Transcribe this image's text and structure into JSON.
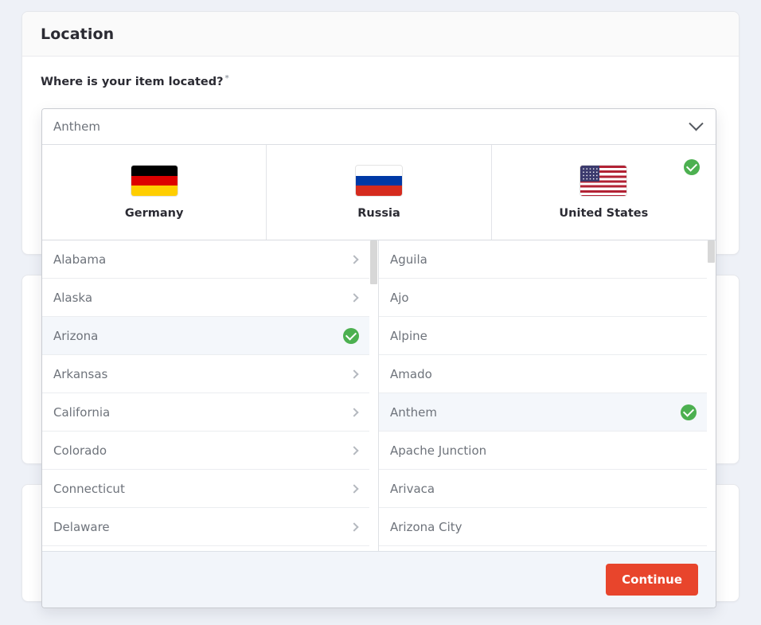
{
  "page": {
    "background_color": "#eef1f7"
  },
  "card_location": {
    "title": "Location",
    "field_label": "Where is your item located?",
    "required_marker": "*"
  },
  "selector": {
    "selected_value": "Anthem",
    "placeholder": "Anthem",
    "chevron_icon": "chevron-down-icon",
    "countries": [
      {
        "name": "Germany",
        "code": "de",
        "flag_icon": "flag-germany-icon",
        "selected": false
      },
      {
        "name": "Russia",
        "code": "ru",
        "flag_icon": "flag-russia-icon",
        "selected": false
      },
      {
        "name": "United States",
        "code": "us",
        "flag_icon": "flag-united-states-icon",
        "selected": true
      }
    ],
    "states": [
      {
        "label": "Alabama",
        "selected": false
      },
      {
        "label": "Alaska",
        "selected": false
      },
      {
        "label": "Arizona",
        "selected": true
      },
      {
        "label": "Arkansas",
        "selected": false
      },
      {
        "label": "California",
        "selected": false
      },
      {
        "label": "Colorado",
        "selected": false
      },
      {
        "label": "Connecticut",
        "selected": false
      },
      {
        "label": "Delaware",
        "selected": false
      }
    ],
    "cities": [
      {
        "label": "Aguila",
        "selected": false
      },
      {
        "label": "Ajo",
        "selected": false
      },
      {
        "label": "Alpine",
        "selected": false
      },
      {
        "label": "Amado",
        "selected": false
      },
      {
        "label": "Anthem",
        "selected": true
      },
      {
        "label": "Apache Junction",
        "selected": false
      },
      {
        "label": "Arivaca",
        "selected": false
      },
      {
        "label": "Arizona City",
        "selected": false
      }
    ],
    "footer": {
      "continue_label": "Continue",
      "continue_color": "#e8452c"
    },
    "check_icon": "check-circle-icon",
    "check_color": "#4cb050",
    "row_chevron_icon": "chevron-right-icon"
  }
}
